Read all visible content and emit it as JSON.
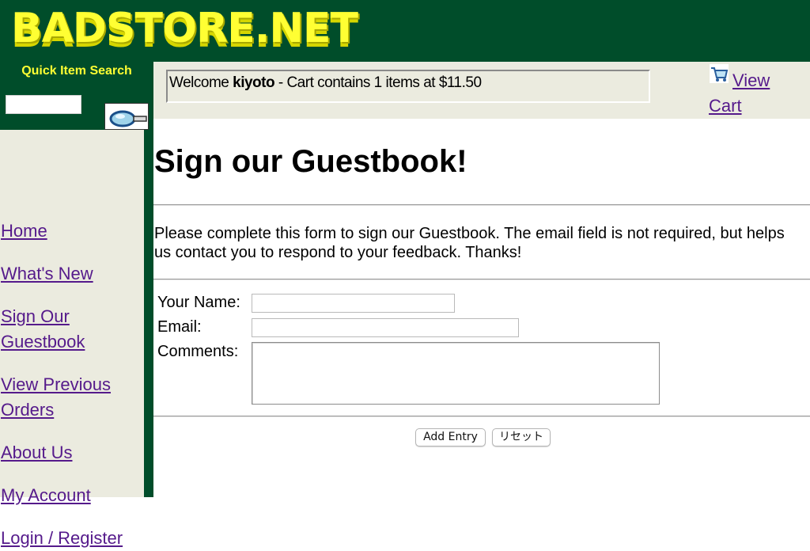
{
  "header": {
    "logo_text": "BADSTORE.NET"
  },
  "sidebar": {
    "quick_search_label": "Quick Item Search",
    "search_value": "",
    "nav": [
      {
        "label": "Home "
      },
      {
        "label": "What's New "
      },
      {
        "label": "Sign Our\nGuestbook "
      },
      {
        "label": "View Previous\nOrders "
      },
      {
        "label": "About Us "
      },
      {
        "label": "My Account"
      },
      {
        "label": "Login / Register"
      }
    ]
  },
  "topbar": {
    "welcome_prefix": "Welcome ",
    "username": "kiyoto",
    "cart_summary": " - Cart contains 1 items at $11.50",
    "view_cart_label": "View Cart"
  },
  "main": {
    "title": "Sign our Guestbook!",
    "intro": "Please complete this form to sign our Guestbook. The email field is not required, but helps us contact you to respond to your feedback. Thanks!",
    "form": {
      "name_label": "Your Name:",
      "name_value": "",
      "email_label": "Email:",
      "email_value": "",
      "comments_label": "Comments:",
      "comments_value": "",
      "submit_label": "Add Entry",
      "reset_label": "リセット"
    }
  },
  "colors": {
    "header_bg": "#004d2a",
    "logo_yellow": "#ffff33",
    "panel_bg": "#ebebdf",
    "link": "#551a8b"
  }
}
